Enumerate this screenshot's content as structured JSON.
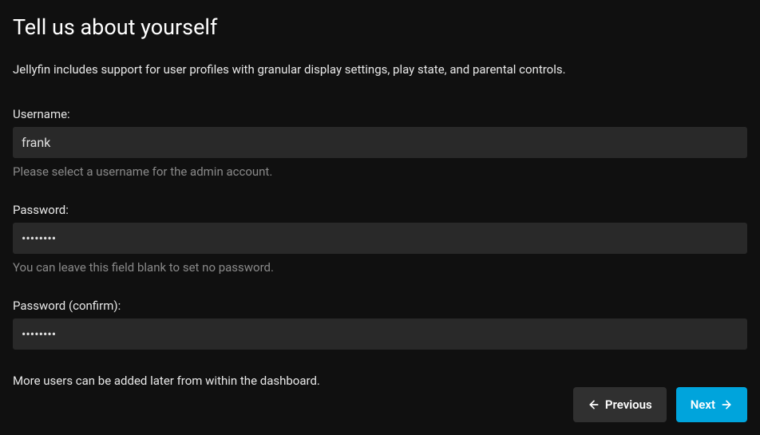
{
  "title": "Tell us about yourself",
  "description": "Jellyfin includes support for user profiles with granular display settings, play state, and parental controls.",
  "fields": {
    "username": {
      "label": "Username:",
      "value": "frank",
      "hint": "Please select a username for the admin account."
    },
    "password": {
      "label": "Password:",
      "value": "••••••••",
      "hint": "You can leave this field blank to set no password."
    },
    "password_confirm": {
      "label": "Password (confirm):",
      "value": "••••••••"
    }
  },
  "footer_note": "More users can be added later from within the dashboard.",
  "buttons": {
    "previous": "Previous",
    "next": "Next"
  }
}
